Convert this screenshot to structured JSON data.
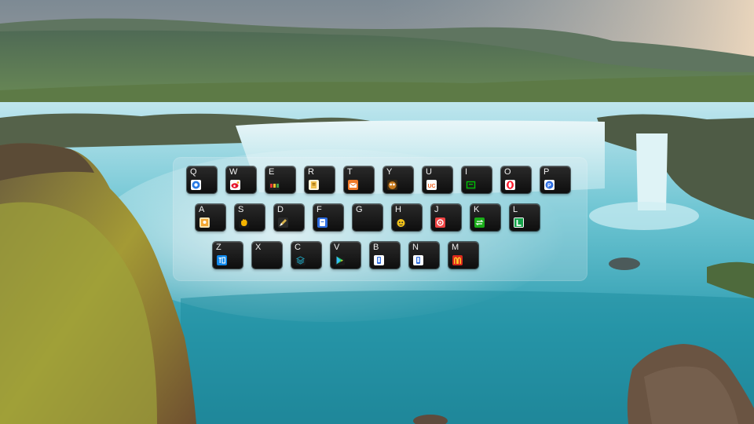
{
  "wallpaper": {
    "description_free": true
  },
  "launcher": {
    "rows": [
      [
        {
          "key": "Q",
          "icon": "chrome-icon",
          "color": "#2a7be4"
        },
        {
          "key": "W",
          "icon": "weibo-icon",
          "color": "#e6162d"
        },
        {
          "key": "E",
          "icon": "bars-app-icon",
          "color": "#e53935"
        },
        {
          "key": "R",
          "icon": "doc-app-icon",
          "color": "#f2c14e"
        },
        {
          "key": "T",
          "icon": "mail-app-icon",
          "color": "#f07b2a"
        },
        {
          "key": "Y",
          "icon": "owl-app-icon",
          "color": "#c87b1e"
        },
        {
          "key": "U",
          "icon": "uc-browser-icon",
          "color": "#f26522"
        },
        {
          "key": "I",
          "icon": "iqiyi-icon",
          "color": "#00be06"
        },
        {
          "key": "O",
          "icon": "opera-icon",
          "color": "#ff1b2d"
        },
        {
          "key": "P",
          "icon": "pinduoduo-icon",
          "color": "#2f6fe4"
        }
      ],
      [
        {
          "key": "A",
          "icon": "photo-app-icon",
          "color": "#f3a633"
        },
        {
          "key": "S",
          "icon": "hand-app-icon",
          "color": "#f5b400"
        },
        {
          "key": "D",
          "icon": "pen-app-icon",
          "color": "#d9b34a"
        },
        {
          "key": "F",
          "icon": "file-app-icon",
          "color": "#2d6cdf"
        },
        {
          "key": "G",
          "icon": "",
          "color": ""
        },
        {
          "key": "H",
          "icon": "pet-app-icon",
          "color": "#f5c518"
        },
        {
          "key": "J",
          "icon": "ring-app-icon",
          "color": "#ef4444"
        },
        {
          "key": "K",
          "icon": "sync-app-icon",
          "color": "#1aad19"
        },
        {
          "key": "L",
          "icon": "l-app-icon",
          "color": "#16a34a"
        }
      ],
      [
        {
          "key": "Z",
          "icon": "zhihu-icon",
          "color": "#0f88eb"
        },
        {
          "key": "X",
          "icon": "",
          "color": ""
        },
        {
          "key": "C",
          "icon": "layers-app-icon",
          "color": "#1f9fb8"
        },
        {
          "key": "V",
          "icon": "play-app-icon",
          "color": "#22c55e"
        },
        {
          "key": "B",
          "icon": "phone-app-icon",
          "color": "#2d6cdf"
        },
        {
          "key": "N",
          "icon": "phone-app-icon",
          "color": "#2d6cdf"
        },
        {
          "key": "M",
          "icon": "mcdonalds-icon",
          "color": "#da291c"
        }
      ]
    ]
  }
}
